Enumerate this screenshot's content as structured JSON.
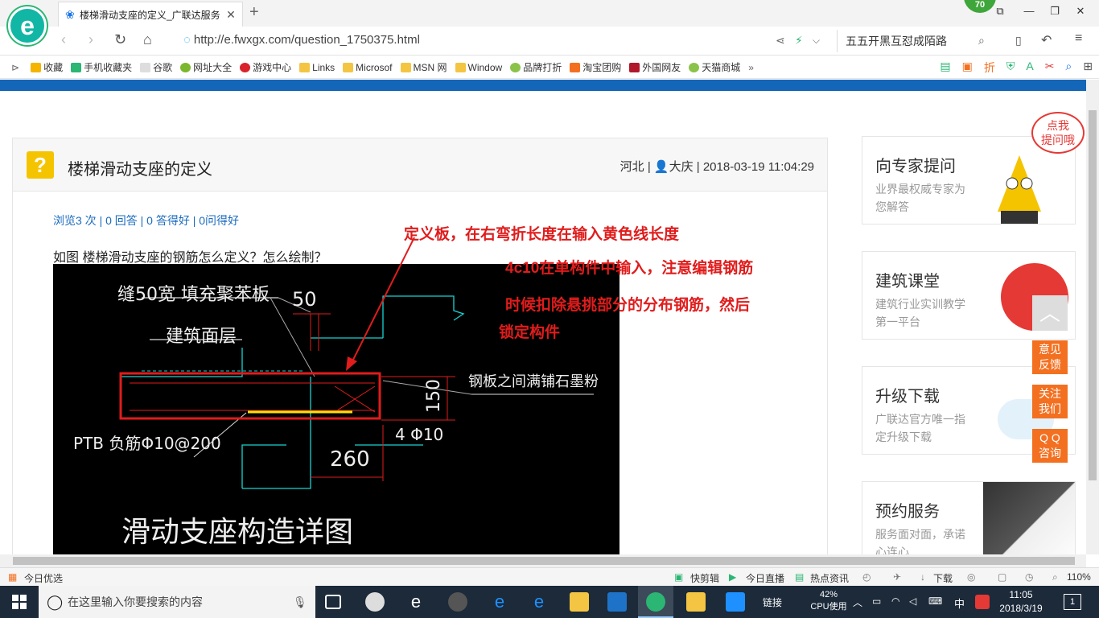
{
  "browser": {
    "tab_title": "楼梯滑动支座的定义_广联达服务",
    "badge": "70",
    "url": "http://e.fwxgx.com/question_1750375.html",
    "search_text": "五五开黑互怼成陌路"
  },
  "bookmarks": [
    "收藏",
    "手机收藏夹",
    "谷歌",
    "网址大全",
    "游戏中心",
    "Links",
    "Microsof",
    "MSN 网",
    "Window",
    "品牌打折",
    "淘宝团购",
    "外国网友",
    "天猫商城"
  ],
  "question": {
    "title": "楼梯滑动支座的定义",
    "region": "河北",
    "user": "大庆",
    "datetime": "2018-03-19 11:04:29",
    "stats": "浏览3 次 | 0 回答 | 0 答得好 | 0问得好",
    "text": "如图 楼梯滑动支座的钢筋怎么定义？怎么绘制？"
  },
  "cad": {
    "labels": {
      "fill": "缝50宽 填充聚苯板",
      "dim50": "50",
      "surface": "建筑面层",
      "graphite": "钢板之间满铺石墨粉",
      "dim150": "150",
      "ptb": "PTB 负筋Φ10@200",
      "bar": "4 Φ10",
      "dim260": "260",
      "caption": "滑动支座构造详图"
    }
  },
  "annotation": {
    "line1": "定义板，在右弯折长度在输入黄色线长度",
    "line2": "4c10在单构件中输入，注意编辑钢筋",
    "line3": "时候扣除悬挑部分的分布钢筋，然后",
    "line4": "锁定构件"
  },
  "sidebar": [
    {
      "title": "向专家提问",
      "sub": "业界最权威专家为您解答"
    },
    {
      "title": "建筑课堂",
      "sub": "建筑行业实训教学第一平台"
    },
    {
      "title": "升级下载",
      "sub": "广联达官方唯一指定升级下载"
    },
    {
      "title": "预约服务",
      "sub": "服务面对面，承诺心连心"
    }
  ],
  "bubble": "点我\n提问哦",
  "float_buttons": [
    "意见\n反馈",
    "关注\n我们",
    "Q Q\n咨询"
  ],
  "statusbar": {
    "left": "今日优选",
    "kuaijianji": "快剪辑",
    "zhibo": "今日直播",
    "news": "热点资讯",
    "download": "下载",
    "zoom": "110%"
  },
  "taskbar": {
    "search_placeholder": "在这里输入你要搜索的内容",
    "links": "链接",
    "cpu_pct": "42%",
    "cpu_label": "CPU使用",
    "ime": "中",
    "time": "11:05",
    "date": "2018/3/19",
    "notif_count": "1"
  },
  "colors": {
    "accent_blue": "#1466b8",
    "orange": "#f37021",
    "annotation_red": "#e01c1c"
  }
}
